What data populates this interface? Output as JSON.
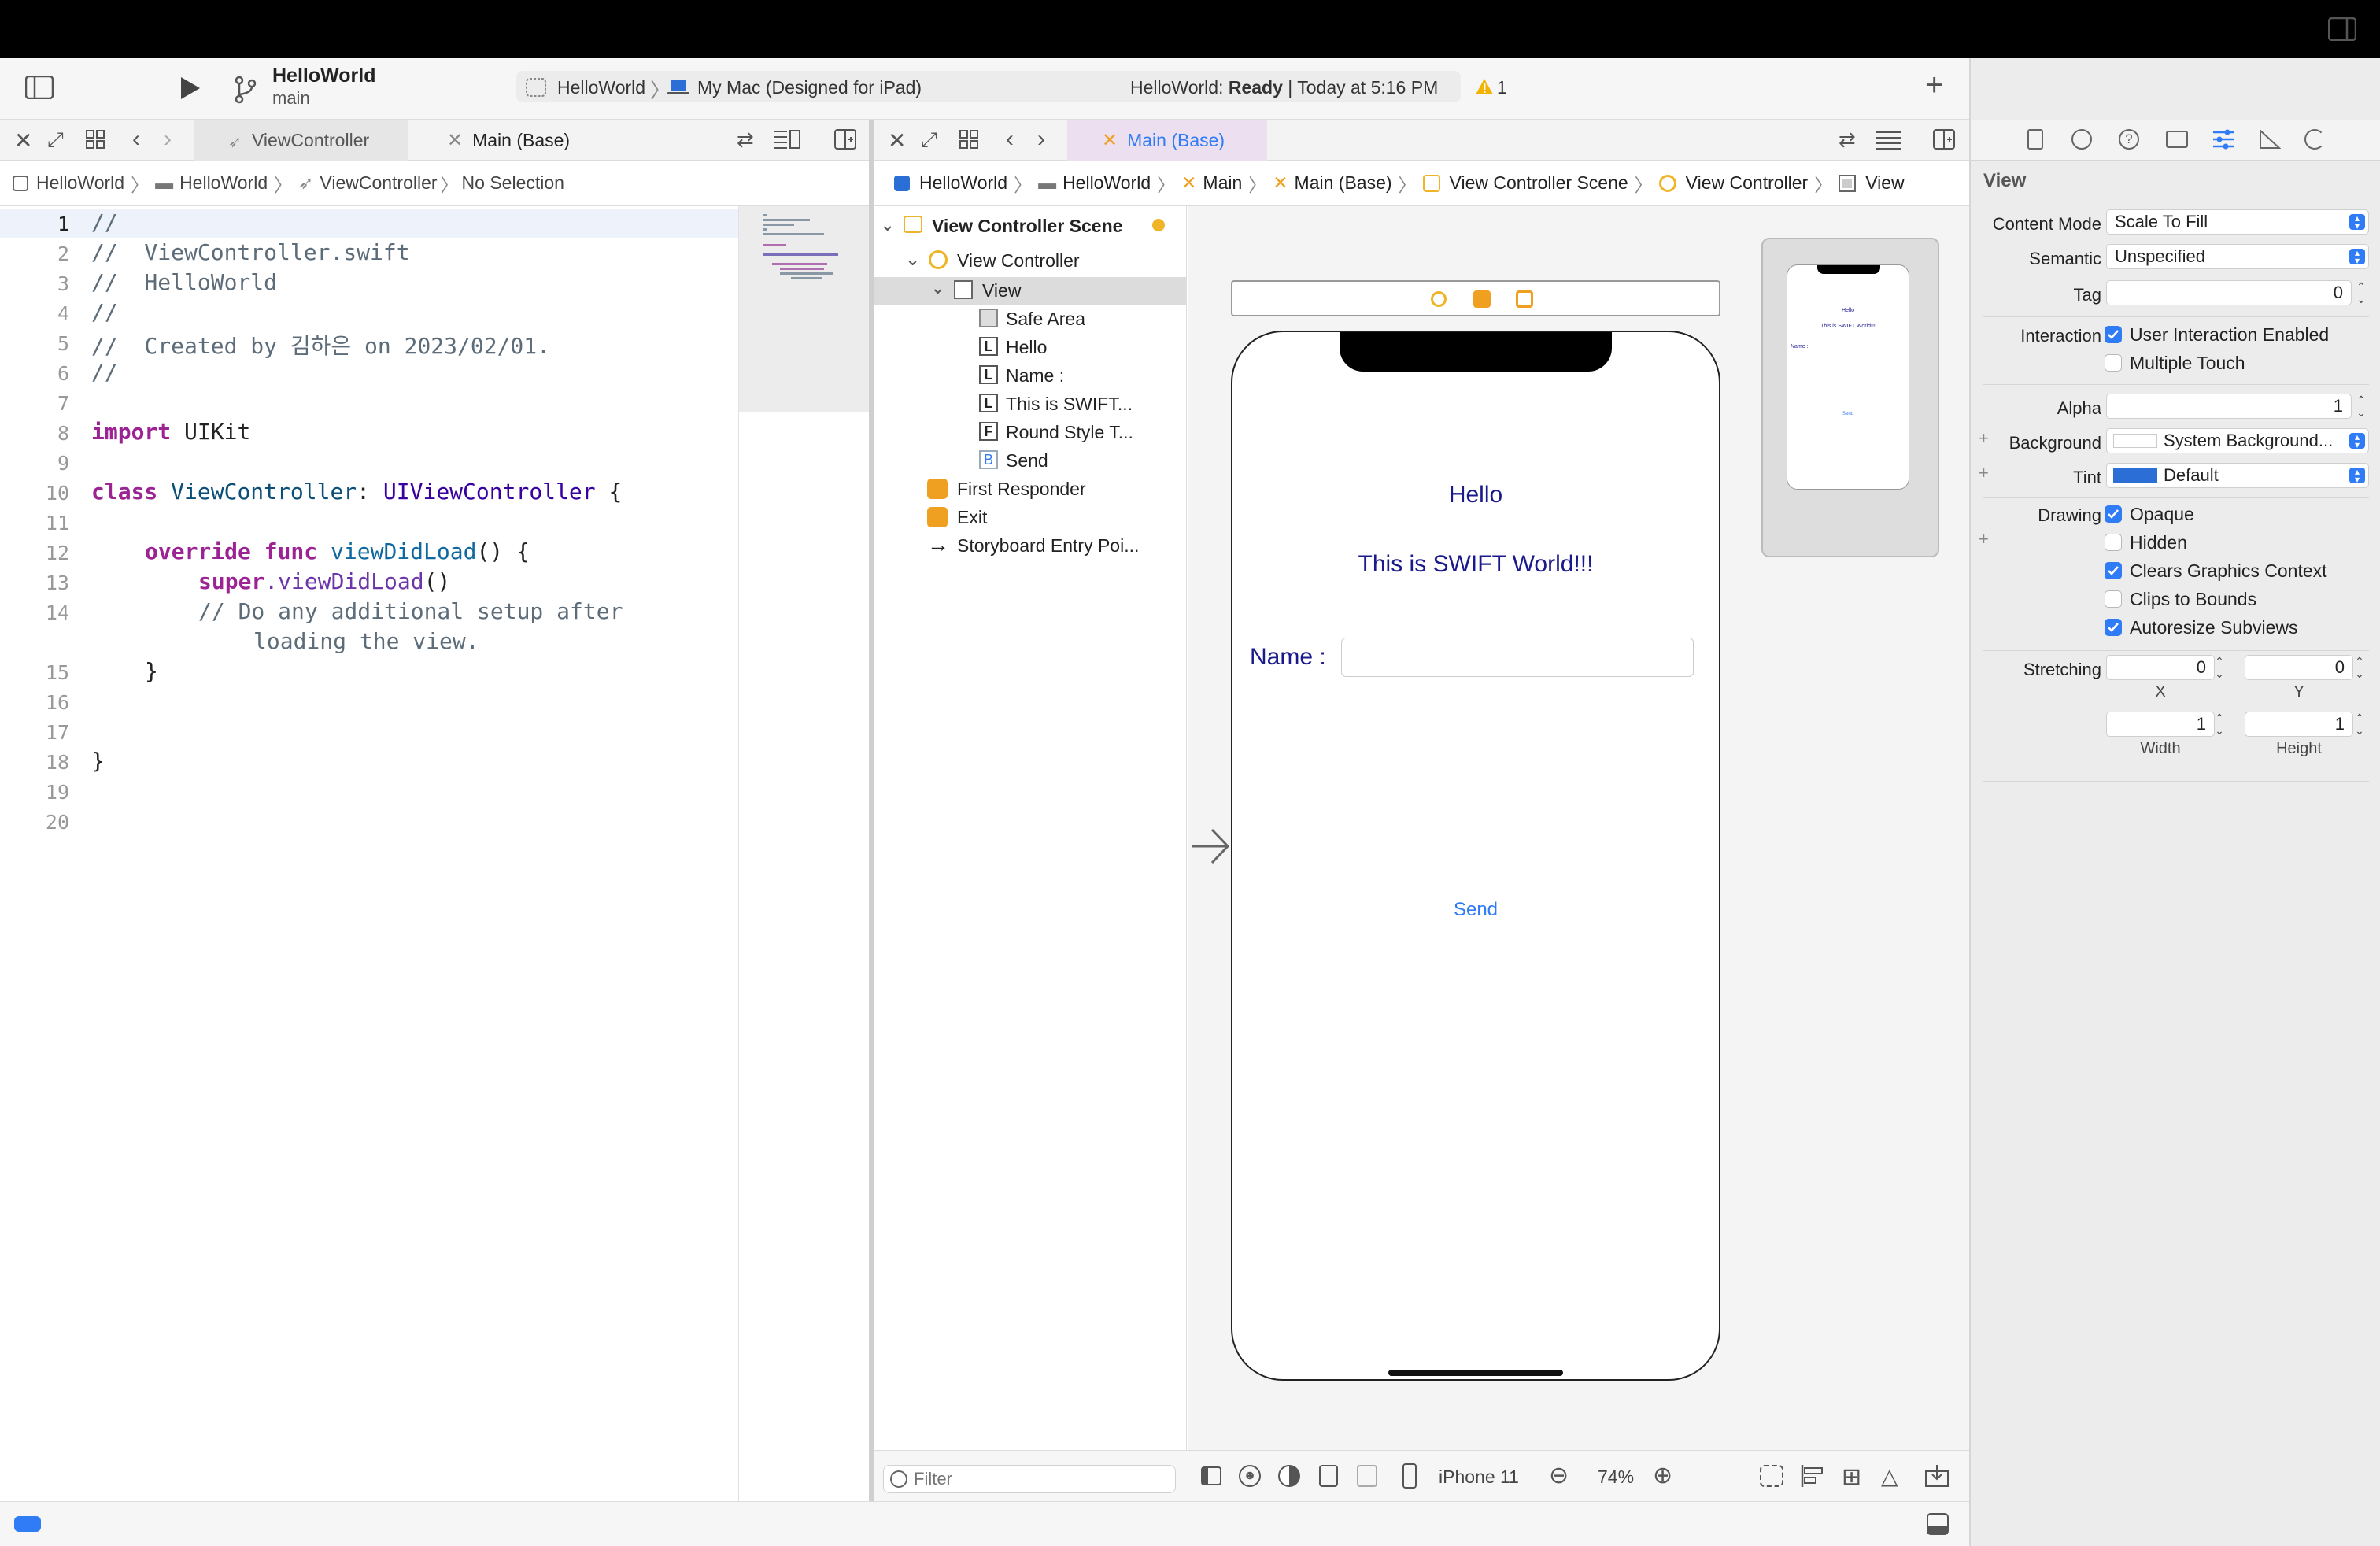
{
  "toolbar": {
    "project_name": "HelloWorld",
    "branch": "main",
    "scheme": "HelloWorld",
    "destination": "My Mac (Designed for iPad)",
    "status_prefix": "HelloWorld: ",
    "status_state": "Ready",
    "status_time": "| Today at 5:16 PM",
    "warning_count": "1"
  },
  "left_editor": {
    "tabs": [
      "ViewController",
      "Main (Base)"
    ],
    "breadcrumb": [
      "HelloWorld",
      "HelloWorld",
      "ViewController",
      "No Selection"
    ],
    "line_numbers": [
      "1",
      "2",
      "3",
      "4",
      "5",
      "6",
      "7",
      "8",
      "9",
      "10",
      "11",
      "12",
      "13",
      "14",
      "15",
      "16",
      "17",
      "18",
      "19",
      "20"
    ],
    "code": {
      "l1": "//",
      "l2": "//  ViewController.swift",
      "l3": "//  HelloWorld",
      "l4": "//",
      "l5": "//  Created by 김하은 on 2023/02/01.",
      "l6": "//",
      "l8_kw": "import",
      "l8_rest": " UIKit",
      "l10_kw": "class",
      "l10_name": " ViewController",
      "l10_colon": ": ",
      "l10_super": "UIViewController",
      "l10_brace": " {",
      "l12_kw": "override func",
      "l12_fn": " viewDidLoad",
      "l12_rest": "() {",
      "l13_kw": "super",
      "l13_fn": ".viewDidLoad",
      "l13_rest": "()",
      "l14a": "// Do any additional setup after",
      "l14b": "loading the view.",
      "l15": "}",
      "l18": "}"
    }
  },
  "right_editor": {
    "tab": "Main (Base)",
    "breadcrumb": [
      "HelloWorld",
      "HelloWorld",
      "Main",
      "Main (Base)",
      "View Controller Scene",
      "View Controller",
      "View"
    ],
    "outline": {
      "scene": "View Controller Scene",
      "view_controller": "View Controller",
      "view": "View",
      "children": [
        {
          "badge": "",
          "label": "Safe Area"
        },
        {
          "badge": "L",
          "label": "Hello"
        },
        {
          "badge": "L",
          "label": "Name :"
        },
        {
          "badge": "L",
          "label": "This is SWIFT..."
        },
        {
          "badge": "F",
          "label": "Round Style T..."
        },
        {
          "badge": "B",
          "label": "Send"
        }
      ],
      "first_responder": "First Responder",
      "exit": "Exit",
      "entry_point": "Storyboard Entry Poi...",
      "filter_placeholder": "Filter"
    },
    "canvas": {
      "hello": "Hello",
      "swift": "This is SWIFT World!!!",
      "name_label": "Name :",
      "send": "Send",
      "mini_hello": "Hello",
      "mini_swift": "This is SWIFT World!!!",
      "mini_name": "Name :",
      "mini_send": "Send"
    },
    "device": "iPhone 11",
    "zoom": "74%"
  },
  "inspector": {
    "section": "View",
    "content_mode_label": "Content Mode",
    "content_mode": "Scale To Fill",
    "semantic_label": "Semantic",
    "semantic": "Unspecified",
    "tag_label": "Tag",
    "tag": "0",
    "interaction_label": "Interaction",
    "user_interaction": "User Interaction Enabled",
    "multiple_touch": "Multiple Touch",
    "alpha_label": "Alpha",
    "alpha": "1",
    "background_label": "Background",
    "background": "System Background...",
    "tint_label": "Tint",
    "tint": "Default",
    "tint_color": "#2b6fd6",
    "drawing_label": "Drawing",
    "opaque": "Opaque",
    "hidden": "Hidden",
    "clears_graphics": "Clears Graphics Context",
    "clips_bounds": "Clips to Bounds",
    "autoresize": "Autoresize Subviews",
    "stretching_label": "Stretching",
    "stretch_x": "0",
    "stretch_y": "0",
    "stretch_w": "1",
    "stretch_h": "1",
    "x_caption": "X",
    "y_caption": "Y",
    "width_caption": "Width",
    "height_caption": "Height"
  },
  "colors": {
    "accent": "#2f7cf6",
    "storyboard_text": "#1a1a8c",
    "warning": "#f2b200",
    "scene_yellow": "#f0b429"
  }
}
